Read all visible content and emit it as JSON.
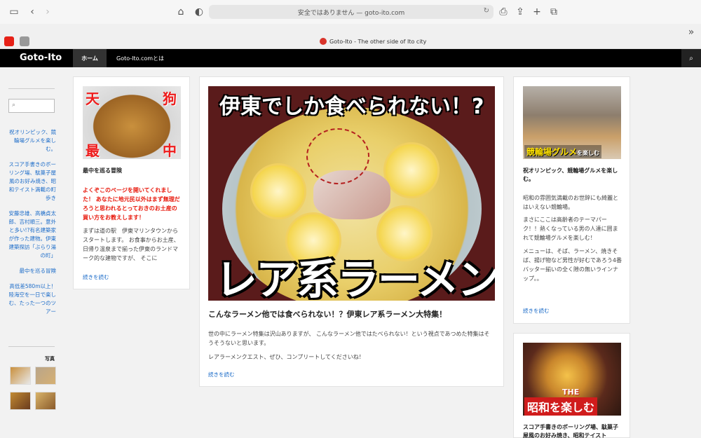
{
  "browser": {
    "url": "安全ではありません — goto-ito.com",
    "tab_title": "Goto-Ito - The other side of Ito city"
  },
  "site": {
    "title": "Goto-Ito",
    "nav": [
      {
        "label": "ホーム",
        "active": true
      },
      {
        "label": "Goto-Ito.comとは",
        "active": false
      }
    ]
  },
  "sidebar": {
    "links": [
      "祝オリンピック、競輪場グルメを楽しむ。",
      "スコア手書きのボーリング場、駄菓子屋風のお好み焼き、昭和テイスト満載の町歩き",
      "安藤忠雄、高橋貞太郎、吉村順三。意外と多い!?有名建築家が作った建物。伊東建築探訪「ぶらり湯の町」",
      "最中を巡る冒険",
      "高低差580m以上！陸海空を一日で楽しむ、たった一つのツアー"
    ],
    "photos_heading": "写真"
  },
  "cards": {
    "monaka": {
      "image_text": [
        "天",
        "狗",
        "最",
        "中"
      ],
      "title": "最中を巡る冒険",
      "intro": "よくぞこのページを開いてくれました！ あなたに地元民以外はまず無理だろうと思われるとっておきのお土産の買い方をお教えします！",
      "text": "まずは道の駅　伊東マリンタウンからスタートします。 お食事からお土産、日帰り温泉まで揃った伊東のランドマーク的な建物ですが、 そこに",
      "more": "続きを読む"
    },
    "ramen": {
      "image_top": "伊東でしか食べられない！?",
      "image_bottom": "レア系ラーメン",
      "title": "こんなラーメン他では食べられない！？伊東レア系ラーメン大特集！",
      "text1": "世の中にラーメン特集は沢山ありますが、 こんなラーメン他ではたべられない！という視点であつめた特集はそうそうないと思います。",
      "text2": "レアラーメンクエスト、ぜひ、コンプリートしてくださいね！",
      "more": "続きを読む"
    },
    "keirin": {
      "image_label": "競輪場グルメ",
      "image_label_small": "を楽しむ",
      "title": "祝オリンピック、競輪場グルメを楽しむ。",
      "text1": "昭和の雰囲気満載のお世辞にも綺麗とはいえない競輪場。",
      "text2": "まさにここは高齢者のテーマパーク！！熱くなっている男の人達に囲まれて競輪場グルメを楽しむ！",
      "text3": "メニューは、そば、ラーメン、焼きそば、揚げ物など男性が好むであろう4番バッター揃いの全く隙の無いラインナップ。。",
      "more": "続きを読む"
    },
    "showa": {
      "image_the": "THE",
      "image_label": "昭和を楽しむ",
      "title": "スコア手書きのボーリング場、駄菓子屋風のお好み焼き、昭和テイスト"
    }
  },
  "colors": {
    "link": "#1e6dc9",
    "intro_red": "#e8190c",
    "navbar": "#000000"
  }
}
